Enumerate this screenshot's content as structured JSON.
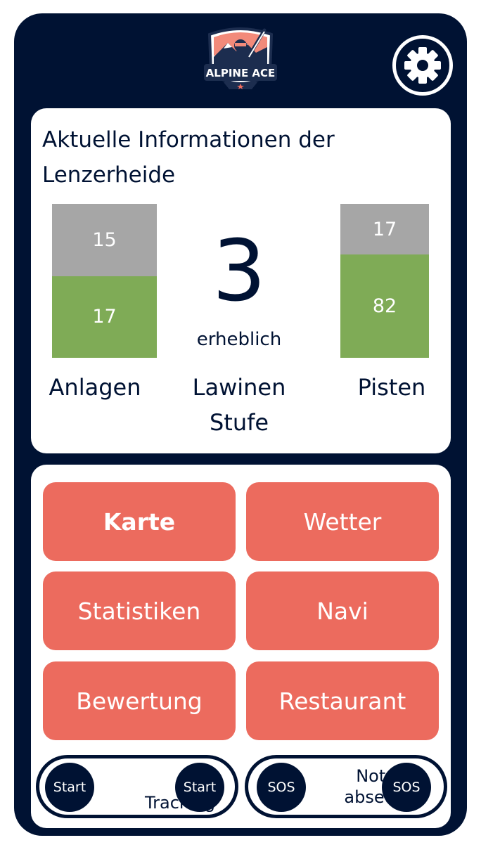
{
  "header": {
    "logo_text": "ALPINE ACE",
    "settings_icon": "gear-icon"
  },
  "info": {
    "title": "Aktuelle Informationen der Lenzerheide",
    "anlagen": {
      "closed": 15,
      "open": 17,
      "label": "Anlagen"
    },
    "lawinen": {
      "level": "3",
      "level_text": "erheblich",
      "label_line1": "Lawinen",
      "label_line2": "Stufe"
    },
    "pisten": {
      "closed": 17,
      "open": 82,
      "label": "Pisten"
    }
  },
  "menu": {
    "karte": "Karte",
    "wetter": "Wetter",
    "statistiken": "Statistiken",
    "navi": "Navi",
    "bewertung": "Bewertung",
    "restaurant": "Restaurant"
  },
  "tracking": {
    "knob_left": "Start",
    "knob_right": "Start",
    "text": "Tracking"
  },
  "notruf": {
    "knob_left": "SOS",
    "knob_right": "SOS",
    "line1": "Notruf",
    "line2": "absetzen"
  },
  "colors": {
    "navy": "#001233",
    "coral": "#ec6b5e",
    "green": "#7fab56",
    "grey": "#a6a6a6"
  }
}
